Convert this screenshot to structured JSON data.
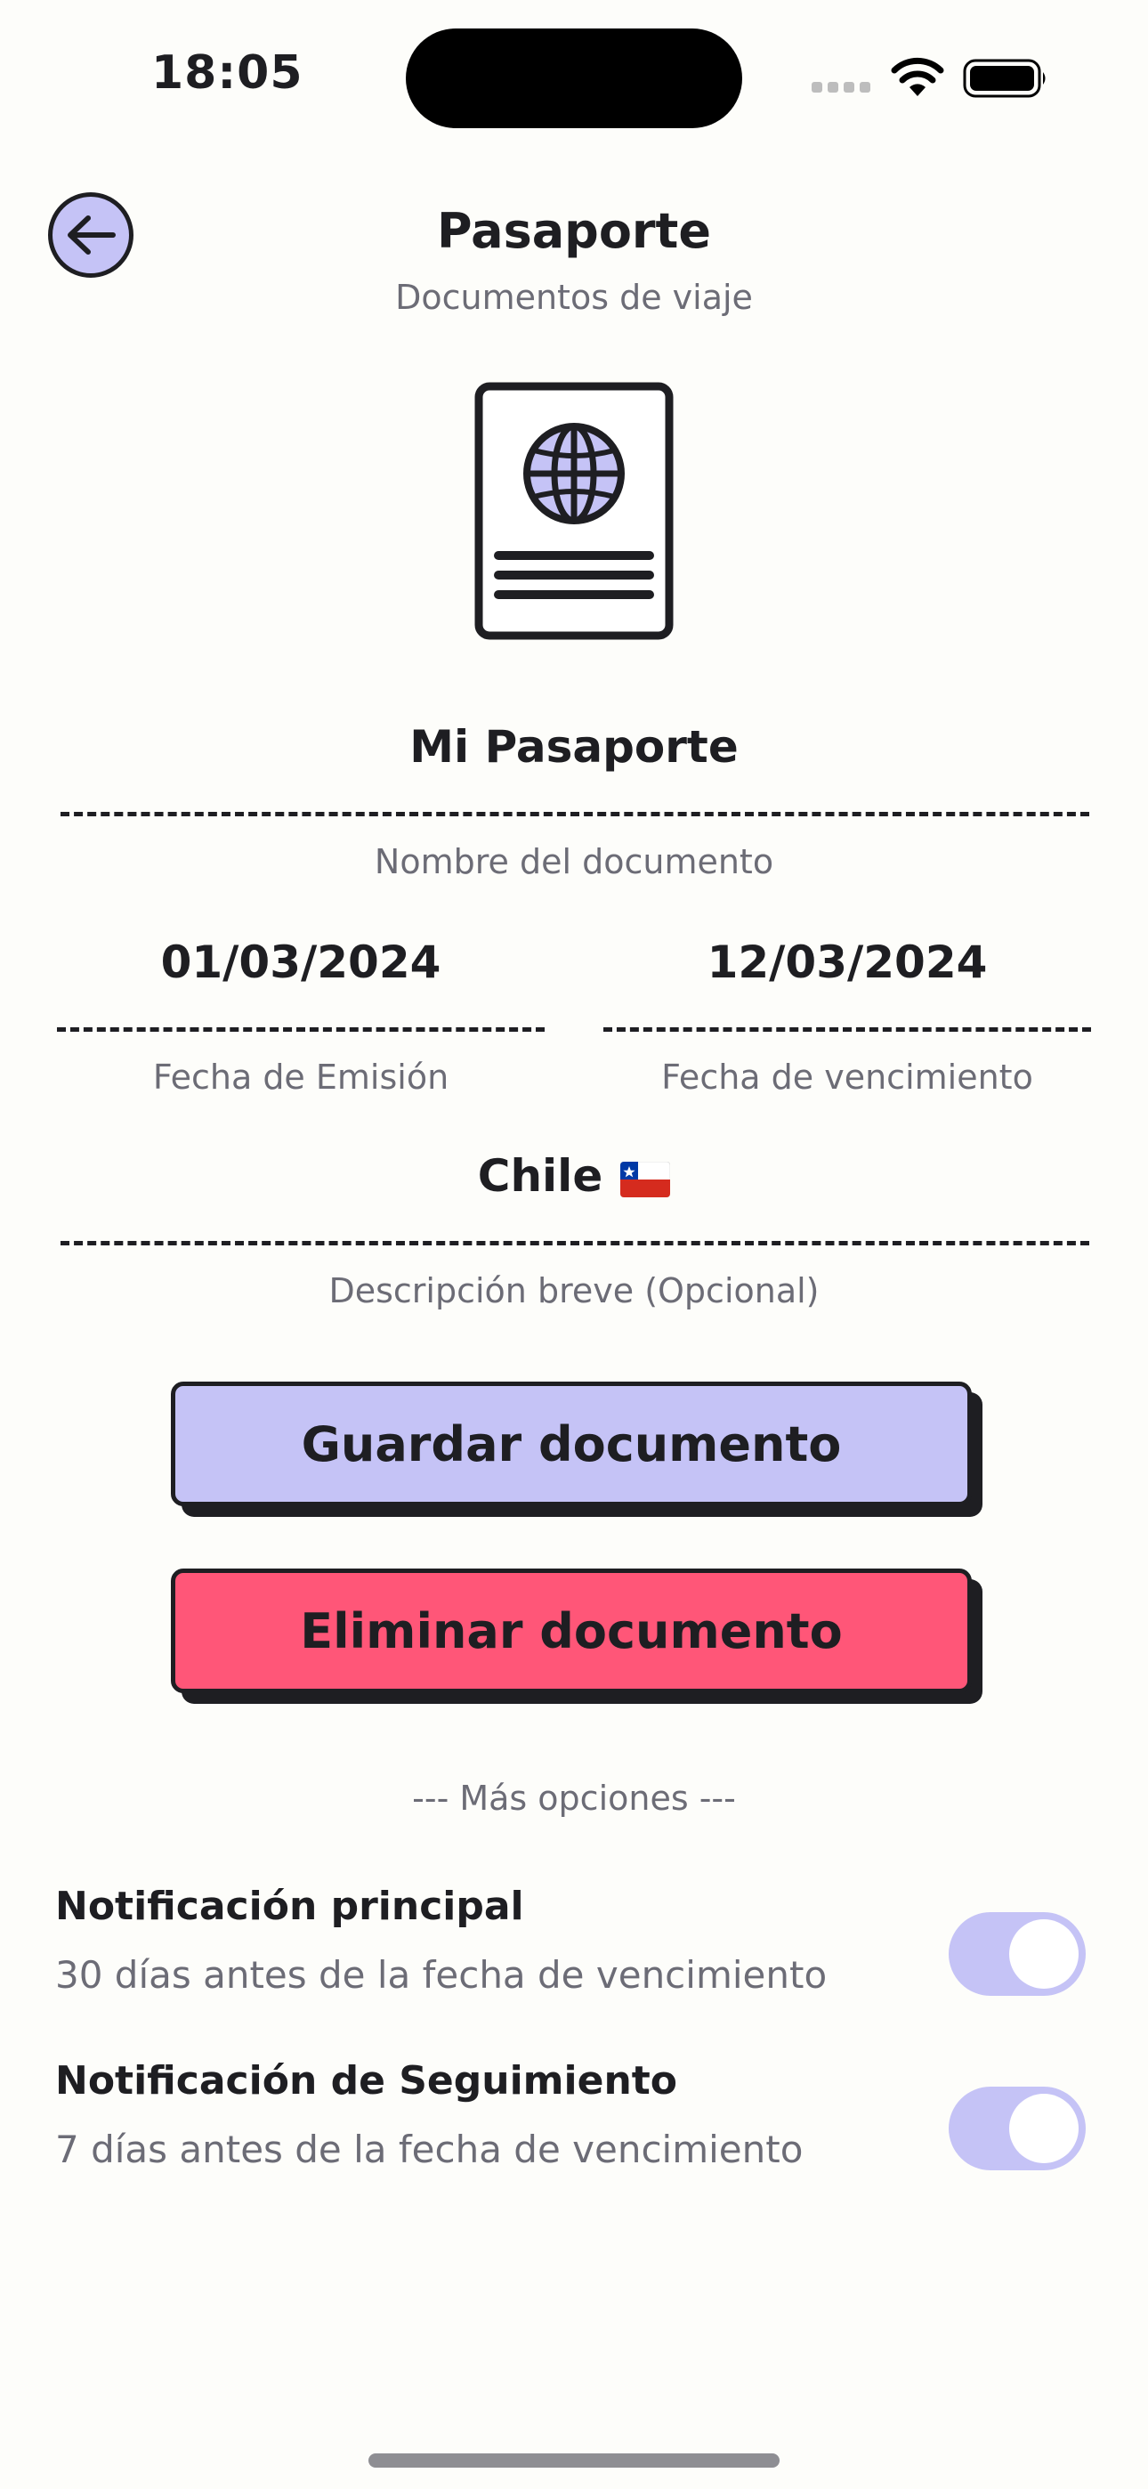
{
  "status_bar": {
    "time": "18:05"
  },
  "header": {
    "title": "Pasaporte",
    "subtitle": "Documentos de viaje",
    "back_icon": "arrow-left-icon",
    "illustration_icon": "passport-globe-icon"
  },
  "form": {
    "document_name": {
      "value": "Mi Pasaporte",
      "label": "Nombre del documento"
    },
    "issue_date": {
      "value": "01/03/2024",
      "label": "Fecha de Emisión"
    },
    "expiry_date": {
      "value": "12/03/2024",
      "label": "Fecha de vencimiento"
    },
    "description": {
      "value": "Chile",
      "flag_icon": "chile-flag-icon",
      "label": "Descripción breve (Opcional)"
    }
  },
  "actions": {
    "save_label": "Guardar documento",
    "delete_label": "Eliminar documento"
  },
  "more_options": "--- Más opciones ---",
  "notifications": [
    {
      "title": "Notificación principal",
      "subtitle": "30 días antes de la fecha de vencimiento",
      "enabled": true
    },
    {
      "title": "Notificación de Seguimiento",
      "subtitle": "7 días antes de la fecha de vencimiento",
      "enabled": true
    }
  ],
  "colors": {
    "background": "#FDFDFA",
    "accent_lavender": "#C5C3F6",
    "danger_pink": "#FF5678",
    "ink": "#1E1E22",
    "muted_text": "#6C6C76"
  }
}
